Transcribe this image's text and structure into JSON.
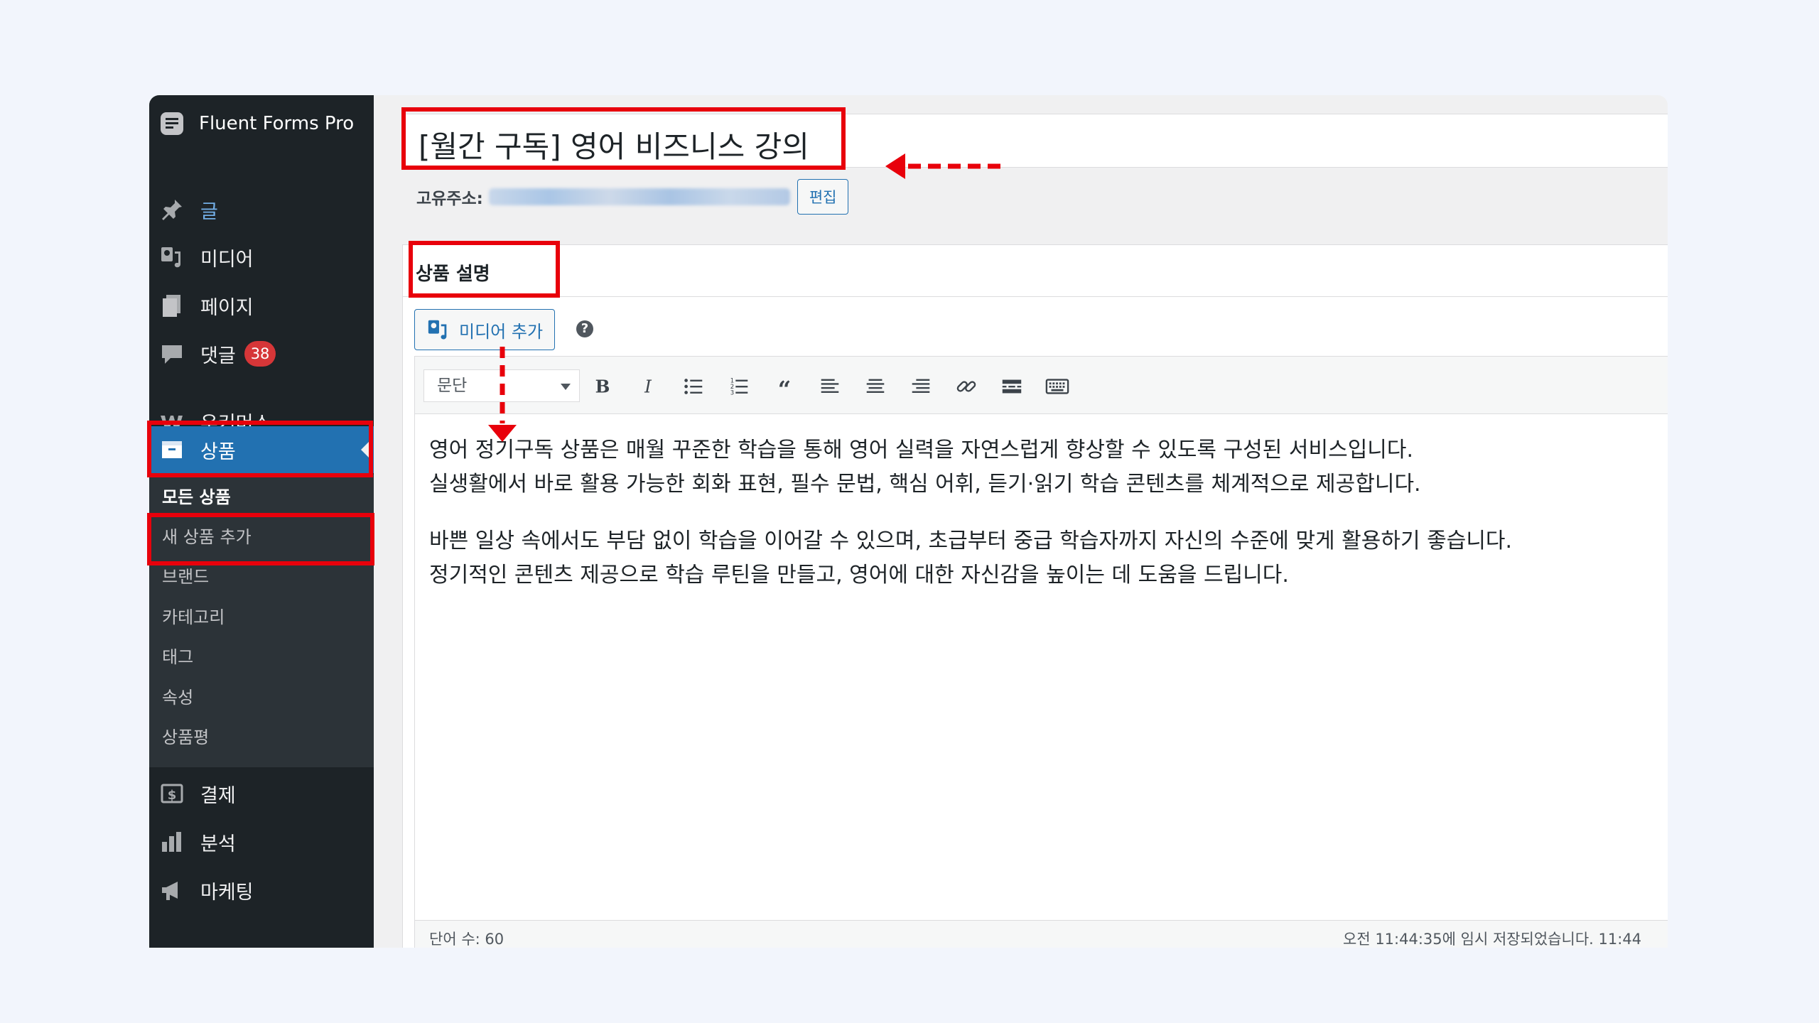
{
  "sidebar": {
    "brand": "Fluent Forms Pro",
    "items": [
      {
        "label": "글",
        "icon": "pin-icon"
      },
      {
        "label": "미디어",
        "icon": "media-icon"
      },
      {
        "label": "페이지",
        "icon": "page-icon"
      },
      {
        "label": "댓글",
        "icon": "comment-icon",
        "badge": "38"
      },
      {
        "label": "우커머스",
        "icon": "woocommerce-icon"
      },
      {
        "label": "상품",
        "icon": "archive-icon",
        "active": true
      },
      {
        "label": "결제",
        "icon": "payment-icon"
      },
      {
        "label": "분석",
        "icon": "bar-chart-icon"
      },
      {
        "label": "마케팅",
        "icon": "megaphone-icon"
      }
    ],
    "submenu": [
      {
        "label": "모든 상품",
        "current": true
      },
      {
        "label": "새 상품 추가"
      },
      {
        "label": "브랜드"
      },
      {
        "label": "카테고리"
      },
      {
        "label": "태그"
      },
      {
        "label": "속성"
      },
      {
        "label": "상품평"
      }
    ]
  },
  "editor": {
    "title": "[월간 구독] 영어 비즈니스 강의",
    "permalink_label": "고유주소:",
    "edit_button": "편집",
    "section_title": "상품 설명",
    "add_media_button": "미디어 추가",
    "help_icon": "?",
    "format_select": "문단",
    "toolbar_buttons": [
      "bold-icon",
      "italic-icon",
      "bulleted-list-icon",
      "numbered-list-icon",
      "blockquote-icon",
      "align-left-icon",
      "align-center-icon",
      "align-right-icon",
      "link-icon",
      "read-more-icon",
      "toolbar-toggle-icon"
    ],
    "paragraphs": [
      [
        "영어 정기구독 상품은 매월 꾸준한 학습을 통해 영어 실력을 자연스럽게 향상할 수 있도록 구성된 서비스입니다.",
        "실생활에서 바로 활용 가능한 회화 표현, 필수 문법, 핵심 어휘, 듣기·읽기 학습 콘텐츠를 체계적으로 제공합니다."
      ],
      [
        "바쁜 일상 속에서도 부담 없이 학습을 이어갈 수 있으며, 초급부터 중급 학습자까지 자신의 수준에 맞게 활용하기 좋습니다.",
        "정기적인 콘텐츠 제공으로 학습 루틴을 만들고, 영어에 대한 자신감을 높이는 데 도움을 드립니다."
      ]
    ],
    "word_count": "단어 수: 60",
    "draft_status": "오전 11:44:35에 임시 저장되었습니다. 11:44"
  },
  "colors": {
    "annotation": "#e8000b",
    "sidebar_bg": "#1d2327",
    "active_bg": "#2271b1",
    "badge": "#d63638"
  }
}
